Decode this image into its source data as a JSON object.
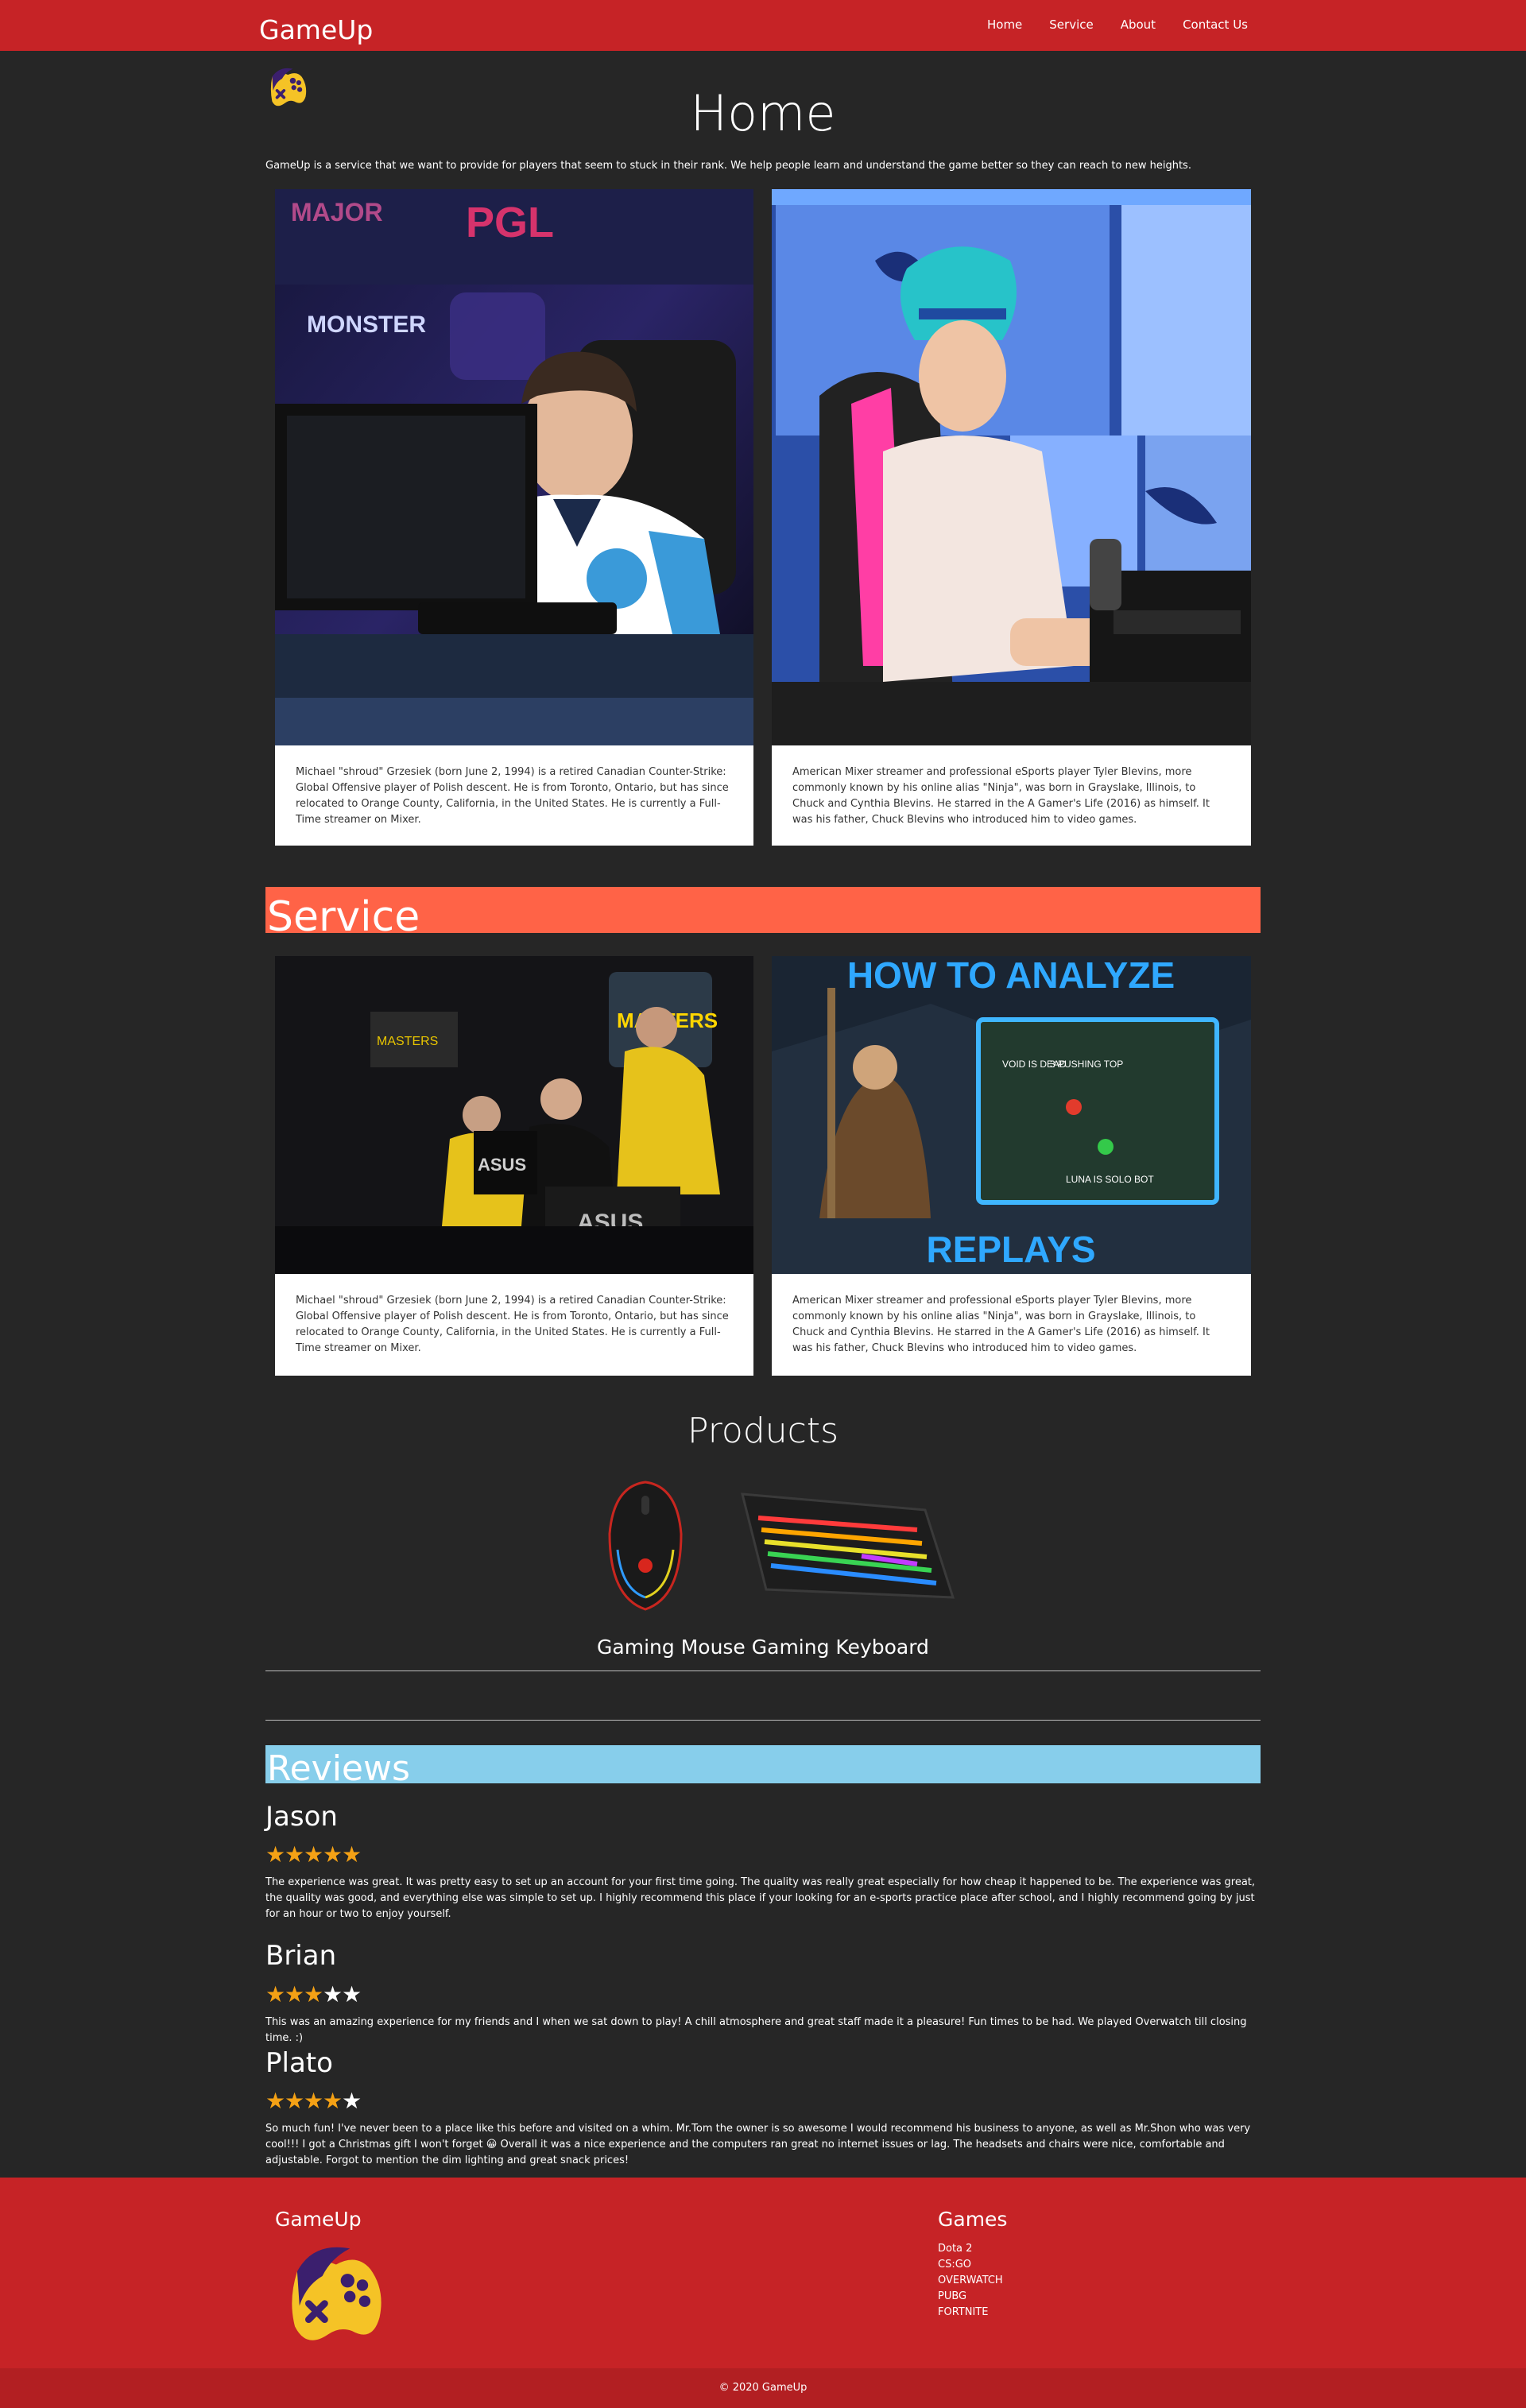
{
  "header": {
    "brand": "GameUp",
    "nav": [
      "Home",
      "Service",
      "About",
      "Contact Us"
    ]
  },
  "home": {
    "title": "Home",
    "intro": "GameUp is a service that we want to provide for players that seem to stuck in their rank. We help people learn and understand the game better so they can reach to new heights.",
    "cards": [
      "Michael \"shroud\" Grzesiek (born June 2, 1994) is a retired Canadian Counter-Strike: Global Offensive player of Polish descent. He is from Toronto, Ontario, but has since relocated to Orange County, California, in the United States. He is currently a Full-Time streamer on Mixer.",
      "American Mixer streamer and professional eSports player Tyler Blevins, more commonly known by his online alias \"Ninja\", was born in Grayslake, Illinois, to Chuck and Cynthia Blevins. He starred in the A Gamer's Life (2016) as himself. It was his father, Chuck Blevins who introduced him to video games."
    ]
  },
  "service": {
    "title": "Service",
    "thumb_top": "HOW TO ANALYZE",
    "thumb_bottom": "REPLAYS",
    "thumb_labels": [
      "VOID IS DEAD",
      "3 PUSHING TOP",
      "LUNA IS SOLO BOT"
    ],
    "cards": [
      "Michael \"shroud\" Grzesiek (born June 2, 1994) is a retired Canadian Counter-Strike: Global Offensive player of Polish descent. He is from Toronto, Ontario, but has since relocated to Orange County, California, in the United States. He is currently a Full-Time streamer on Mixer.",
      "American Mixer streamer and professional eSports player Tyler Blevins, more commonly known by his online alias \"Ninja\", was born in Grayslake, Illinois, to Chuck and Cynthia Blevins. He starred in the A Gamer's Life (2016) as himself. It was his father, Chuck Blevins who introduced him to video games."
    ]
  },
  "products": {
    "title": "Products",
    "caption": "Gaming Mouse Gaming Keyboard"
  },
  "reviews": {
    "title": "Reviews",
    "items": [
      {
        "name": "Jason",
        "rating": 5,
        "text": "The experience was great. It was pretty easy to set up an account for your first time going. The quality was really great especially for how cheap it happened to be. The experience was great, the quality was good, and everything else was simple to set up. I highly recommend this place if your looking for an e-sports practice place after school, and I highly recommend going by just for an hour or two to enjoy yourself."
      },
      {
        "name": "Brian",
        "rating": 3,
        "text": "This was an amazing experience for my friends and I when we sat down to play! A chill atmosphere and great staff made it a pleasure! Fun times to be had. We played Overwatch till closing time. :)"
      },
      {
        "name": "Plato",
        "rating": 4,
        "text": "So much fun! I've never been to a place like this before and visited on a whim. Mr.Tom the owner is so awesome I would recommend his business to anyone, as well as Mr.Shon who was very cool!!! I got a Christmas gift I won't forget 😀 Overall it was a nice experience and the computers ran great no internet issues or lag. The headsets and chairs were nice, comfortable and adjustable. Forgot to mention the dim lighting and great snack prices!"
      }
    ]
  },
  "footer": {
    "brand": "GameUp",
    "games_title": "Games",
    "games": [
      "Dota 2",
      "CS:GO",
      "OVERWATCH",
      "PUBG",
      "FORTNITE"
    ],
    "copyright": "© 2020 GameUp"
  },
  "colors": {
    "header_red": "#c62326",
    "service_band": "#ff6347",
    "reviews_band": "#87ceeb",
    "star_on": "#f4a115",
    "page_bg": "#262626"
  }
}
